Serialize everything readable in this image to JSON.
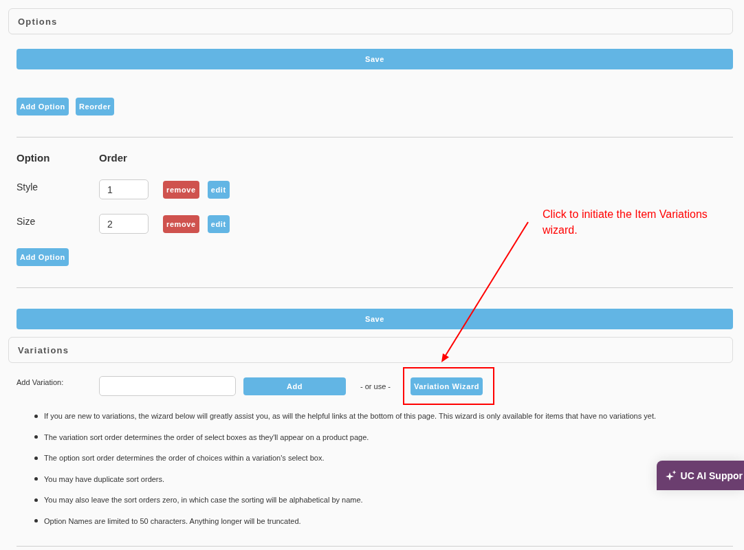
{
  "options": {
    "title": "Options",
    "save_button": "Save",
    "add_option_button": "Add Option",
    "reorder_button": "Reorder",
    "table": {
      "columns": [
        "Option",
        "Order"
      ],
      "rows": [
        {
          "option": "Style",
          "order": "1",
          "remove_button": "remove",
          "edit_button": "edit"
        },
        {
          "option": "Size",
          "order": "2",
          "remove_button": "remove",
          "edit_button": "edit"
        }
      ]
    },
    "add_option_button_bottom": "Add Option",
    "save_button_bottom": "Save"
  },
  "variations": {
    "title": "Variations",
    "add_label": "Add Variation:",
    "add_button": "Add",
    "separator": "- or use -",
    "wizard_button": "Variation Wizard",
    "notes": [
      "If you are new to variations, the wizard below will greatly assist you, as will the helpful links at the bottom of this page. This wizard is only available for items that have no variations yet.",
      "The variation sort order determines the order of select boxes as they'll appear on a product page.",
      "The option sort order determines the order of choices within a variation's select box.",
      "You may have duplicate sort orders.",
      "You may also leave the sort orders zero, in which case the sorting will be alphabetical by name.",
      "Option Names are limited to 50 characters. Anything longer will be truncated."
    ]
  },
  "annotation": {
    "text": "Click to initiate the Item Variations wizard."
  },
  "support_widget": {
    "label": "UC AI Suppor"
  }
}
